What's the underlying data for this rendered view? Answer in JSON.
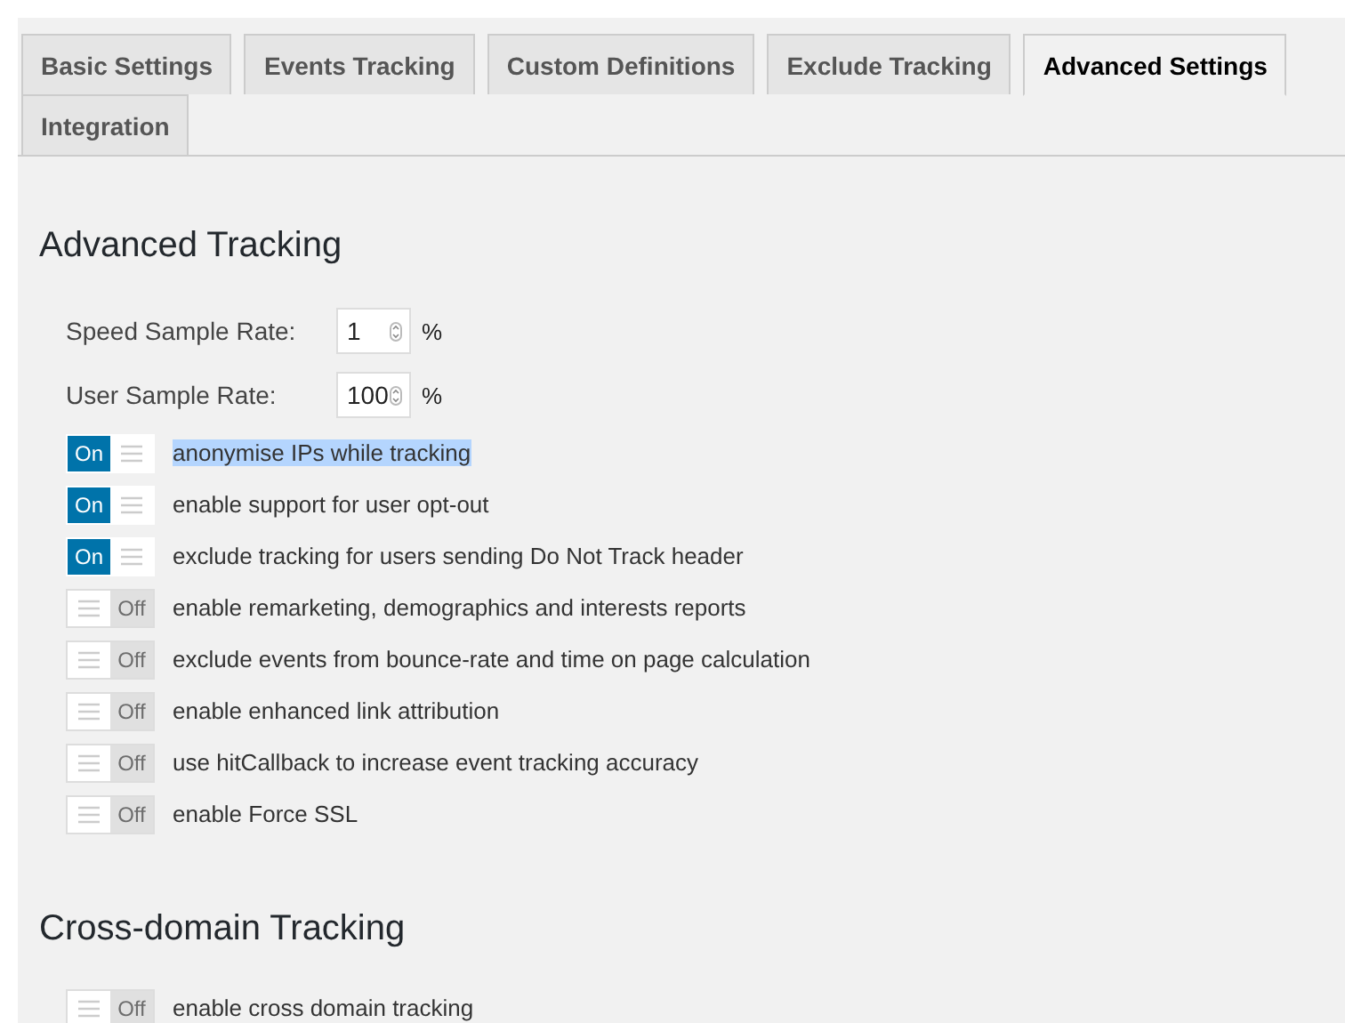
{
  "tabs": [
    {
      "label": "Basic Settings",
      "selected": false
    },
    {
      "label": "Events Tracking",
      "selected": false
    },
    {
      "label": "Custom Definitions",
      "selected": false
    },
    {
      "label": "Exclude Tracking",
      "selected": false
    },
    {
      "label": "Advanced Settings",
      "selected": true
    },
    {
      "label": "Integration",
      "selected": false
    }
  ],
  "sections": [
    {
      "title": "Advanced Tracking",
      "fields": [
        {
          "label": "Speed Sample Rate:",
          "value": "1",
          "unit": "%"
        },
        {
          "label": "User Sample Rate:",
          "value": "100",
          "unit": "%"
        }
      ],
      "toggles": [
        {
          "state_text": "On",
          "on": true,
          "label": "anonymise IPs while tracking",
          "highlighted": true
        },
        {
          "state_text": "On",
          "on": true,
          "label": "enable support for user opt-out",
          "highlighted": false
        },
        {
          "state_text": "On",
          "on": true,
          "label": "exclude tracking for users sending Do Not Track header",
          "highlighted": false
        },
        {
          "state_text": "Off",
          "on": false,
          "label": "enable remarketing, demographics and interests reports",
          "highlighted": false
        },
        {
          "state_text": "Off",
          "on": false,
          "label": "exclude events from bounce-rate and time on page calculation",
          "highlighted": false
        },
        {
          "state_text": "Off",
          "on": false,
          "label": "enable enhanced link attribution",
          "highlighted": false
        },
        {
          "state_text": "Off",
          "on": false,
          "label": "use hitCallback to increase event tracking accuracy",
          "highlighted": false
        },
        {
          "state_text": "Off",
          "on": false,
          "label": "enable Force SSL",
          "highlighted": false
        }
      ]
    },
    {
      "title": "Cross-domain Tracking",
      "toggles": [
        {
          "state_text": "Off",
          "on": false,
          "label": "enable cross domain tracking",
          "highlighted": false
        }
      ]
    }
  ]
}
